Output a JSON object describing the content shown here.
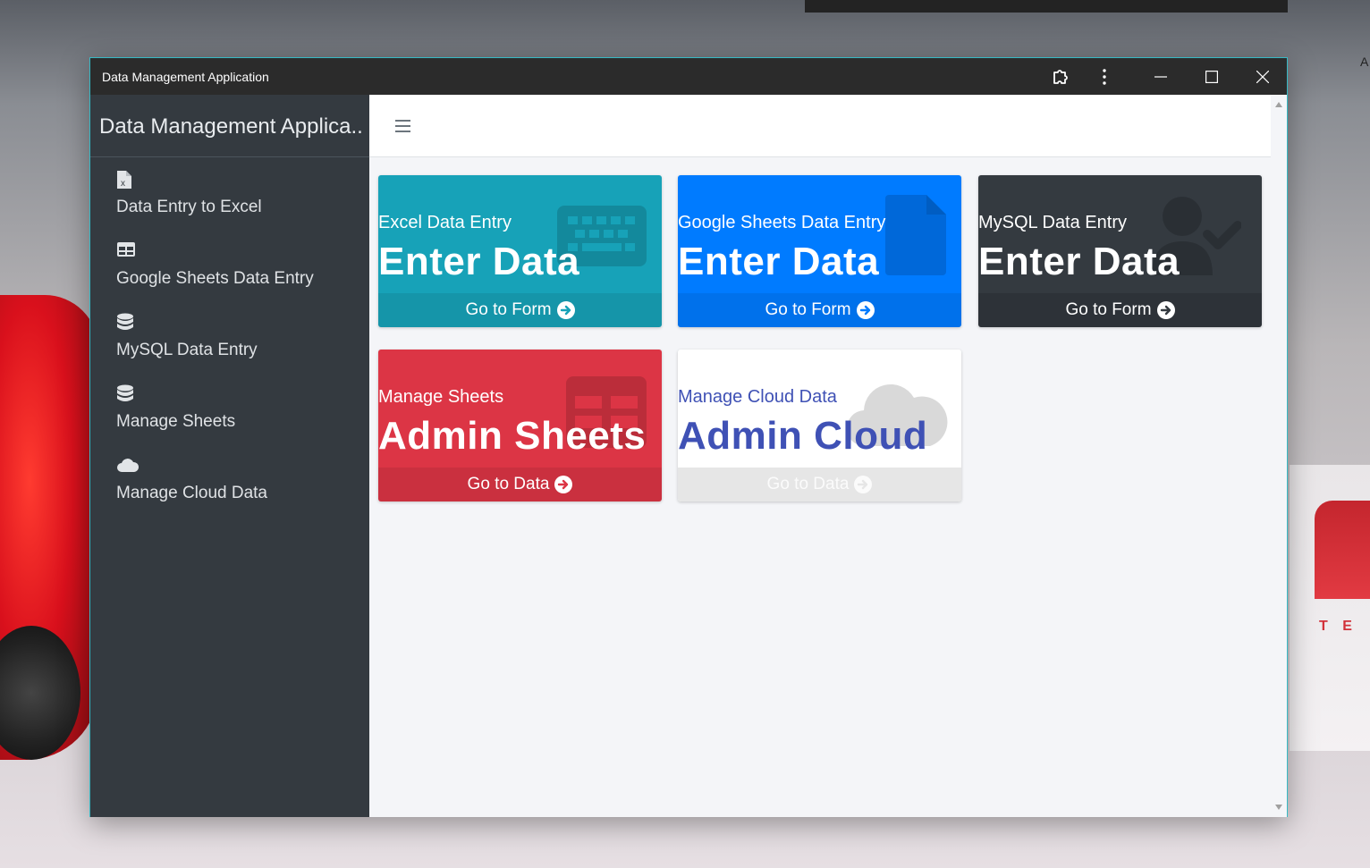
{
  "window": {
    "title": "Data Management Application",
    "controls": [
      "extension-icon",
      "more-vertical-icon",
      "minimize-icon",
      "maximize-icon",
      "close-icon"
    ]
  },
  "sidebar": {
    "brand": "Data Management Applica..",
    "items": [
      {
        "label": "Data Entry to Excel",
        "icon": "excel-file-icon"
      },
      {
        "label": "Google Sheets Data Entry",
        "icon": "table-icon"
      },
      {
        "label": "MySQL Data Entry",
        "icon": "database-icon"
      },
      {
        "label": "Manage Sheets",
        "icon": "database-icon"
      },
      {
        "label": "Manage Cloud Data",
        "icon": "cloud-icon"
      }
    ]
  },
  "cards": [
    {
      "subtitle": "Excel Data Entry",
      "title": "Enter Data",
      "footer": "Go to Form",
      "icon": "keyboard-icon",
      "color": "#17a2b8"
    },
    {
      "subtitle": "Google Sheets Data Entry",
      "title": "Enter Data",
      "footer": "Go to Form",
      "icon": "file-icon",
      "color": "#007bff"
    },
    {
      "subtitle": "MySQL Data Entry",
      "title": "Enter Data",
      "footer": "Go to Form",
      "icon": "user-check-icon",
      "color": "#343a40"
    },
    {
      "subtitle": "Manage Sheets",
      "title": "Admin Sheets",
      "footer": "Go to Data",
      "icon": "table-icon",
      "color": "#dc3545"
    },
    {
      "subtitle": "Manage Cloud Data",
      "title": "Admin Cloud",
      "footer": "Go to Data",
      "icon": "cloud-icon",
      "color": "#ffffff"
    }
  ],
  "background": {
    "edge_text": "A",
    "brand_text": "T E"
  }
}
